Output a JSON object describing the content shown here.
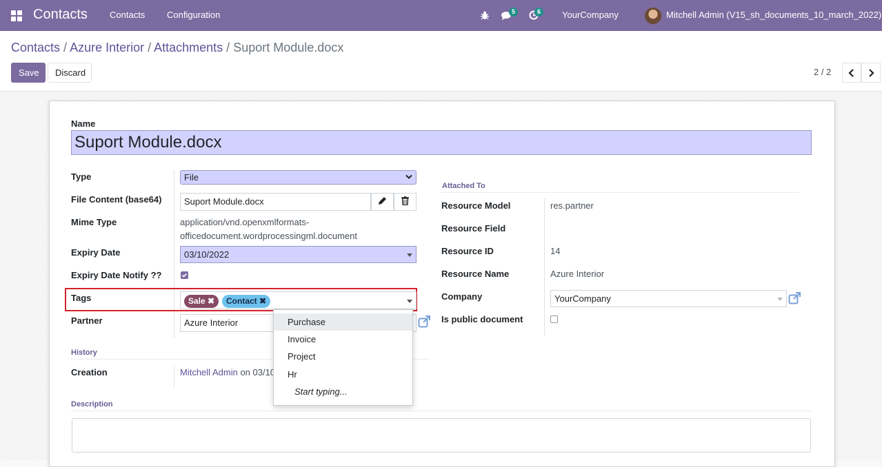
{
  "navbar": {
    "app_title": "Contacts",
    "menu": [
      "Contacts",
      "Configuration"
    ],
    "messages_count": "5",
    "activities_count": "6",
    "company": "YourCompany",
    "user": "Mitchell Admin (V15_sh_documents_10_march_2022)",
    "color": "#7c6ba0"
  },
  "breadcrumb": {
    "items": [
      "Contacts",
      "Azure Interior",
      "Attachments"
    ],
    "current": "Suport Module.docx"
  },
  "actions": {
    "save": "Save",
    "discard": "Discard"
  },
  "pager": {
    "value": "2 / 2"
  },
  "form": {
    "name_label": "Name",
    "name_value": "Suport Module.docx",
    "type_label": "Type",
    "type_value": "File",
    "file_content_label": "File Content (base64)",
    "file_content_value": "Suport Module.docx",
    "mime_label": "Mime Type",
    "mime_value_line1": "application/vnd.openxmlformats-",
    "mime_value_line2": "officedocument.wordprocessingml.document",
    "expiry_label": "Expiry Date",
    "expiry_value": "03/10/2022",
    "expiry_notify_label": "Expiry Date Notify ??",
    "expiry_notify_checked": true,
    "tags_label": "Tags",
    "tags": [
      {
        "name": "Sale",
        "color": "#874a64"
      },
      {
        "name": "Contact",
        "color": "#6cc1ed"
      }
    ],
    "partner_label": "Partner",
    "partner_value": "Azure Interior",
    "history_section": "History",
    "creation_label": "Creation",
    "creation_user": "Mitchell Admin",
    "creation_text": "on 03/10",
    "description_section": "Description",
    "attached_section": "Attached To",
    "resource_model_label": "Resource Model",
    "resource_model_value": "res.partner",
    "resource_field_label": "Resource Field",
    "resource_id_label": "Resource ID",
    "resource_id_value": "14",
    "resource_name_label": "Resource Name",
    "resource_name_value": "Azure Interior",
    "company_label": "Company",
    "company_value": "YourCompany",
    "public_label": "Is public document",
    "public_checked": false
  },
  "tags_dropdown": {
    "options": [
      "Purchase",
      "Invoice",
      "Project",
      "Hr"
    ],
    "hint": "Start typing..."
  }
}
